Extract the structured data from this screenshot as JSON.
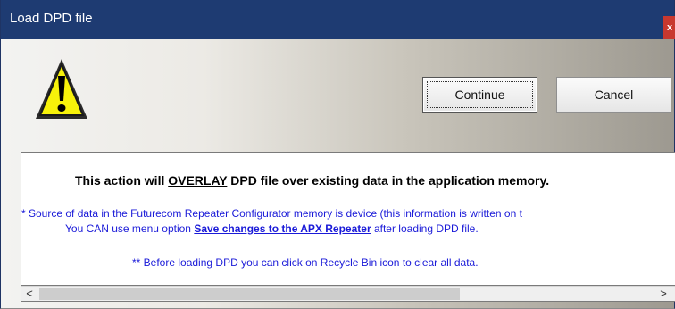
{
  "window": {
    "title": "Load DPD file",
    "close_label": "x"
  },
  "icons": {
    "warning": "warning-triangle-icon"
  },
  "buttons": {
    "continue_label": "Continue",
    "cancel_label": "Cancel"
  },
  "message": {
    "line1_before": "This action will ",
    "line1_emph": "OVERLAY",
    "line1_after": " DPD file over existing data in the application memory.",
    "line2": "* Source of data in the Futurecom Repeater Configurator memory is  device (this information is written on t",
    "line3_before": "You CAN  use menu option ",
    "line3_link": "Save changes to the APX Repeater",
    "line3_after": " after loading DPD file.",
    "line4": "** Before loading DPD you can click on Recycle Bin icon to clear all data."
  },
  "scrollbar": {
    "left_arrow": "<",
    "right_arrow": ">"
  },
  "colors": {
    "titlebar": "#1e3b72",
    "info_text": "#1a1ad8",
    "close": "#c8382f"
  }
}
